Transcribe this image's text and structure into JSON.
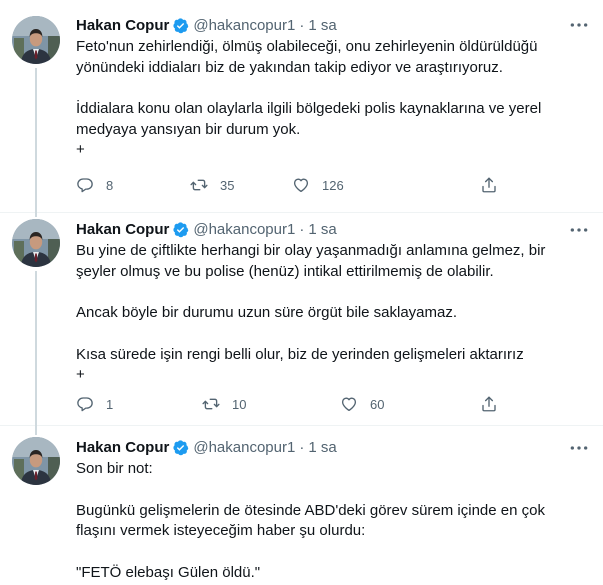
{
  "tweets": [
    {
      "name": "Hakan Copur",
      "handle": "@hakancopur1",
      "dot": "·",
      "time": "1 sa",
      "paragraphs": [
        "Feto'nun zehirlendiği, ölmüş olabileceği, onu zehirleyenin öldürüldüğü yönündeki iddiaları biz de yakından takip ediyor ve araştırıyoruz.",
        "İddialara konu olan olaylarla ilgili bölgedeki polis kaynaklarına ve yerel medyaya yansıyan bir durum yok.\n+"
      ],
      "replies": "8",
      "retweets": "35",
      "likes": "126"
    },
    {
      "name": "Hakan Copur",
      "handle": "@hakancopur1",
      "dot": "·",
      "time": "1 sa",
      "paragraphs": [
        "Bu yine de çiftlikte herhangi bir olay yaşanmadığı anlamına gelmez, bir şeyler olmuş ve bu polise (henüz) intikal ettirilmemiş de olabilir.",
        "Ancak böyle bir durumu uzun süre örgüt bile saklayamaz.",
        "Kısa sürede işin rengi belli olur, biz de yerinden gelişmeleri aktarırız\n+"
      ],
      "replies": "1",
      "retweets": "10",
      "likes": "60"
    },
    {
      "name": "Hakan Copur",
      "handle": "@hakancopur1",
      "dot": "·",
      "time": "1 sa",
      "paragraphs": [
        "Son bir not:",
        "Bugünkü gelişmelerin de ötesinde ABD'deki görev sürem içinde en çok flaşını vermek isteyeceğim haber şu olurdu:",
        "\"FETÖ elebaşı Gülen öldü.\""
      ]
    }
  ],
  "colors": {
    "text": "#0f1419",
    "secondary": "#536471",
    "verified": "#1d9bf0",
    "divider": "#eff3f4"
  },
  "icons": [
    "verified-badge-icon",
    "more-icon",
    "reply-icon",
    "retweet-icon",
    "like-icon",
    "share-icon"
  ]
}
